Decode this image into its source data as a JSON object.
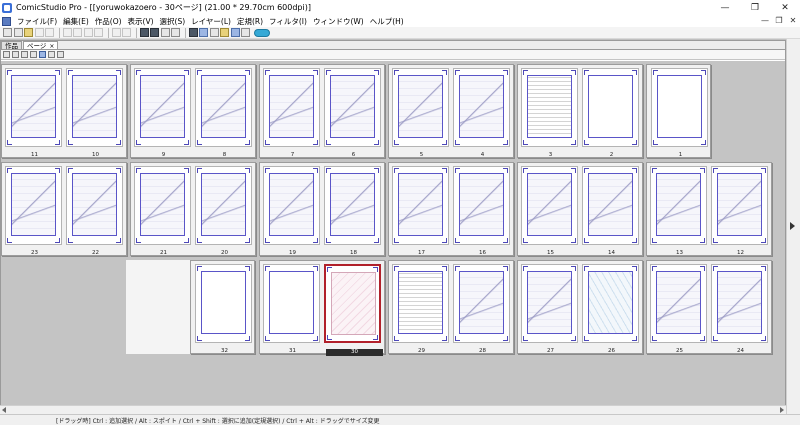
{
  "window": {
    "title": "ComicStudio Pro - [[yoruwokazoero - 30ページ] (21.00 * 29.70cm 600dpi)]",
    "controls": [
      "—",
      "❐",
      "✕"
    ]
  },
  "menu": {
    "items": [
      "ファイル(F)",
      "編集(E)",
      "作品(O)",
      "表示(V)",
      "選択(S)",
      "レイヤー(L)",
      "定規(R)",
      "フィルタ(I)",
      "ウィンドウ(W)",
      "ヘルプ(H)"
    ],
    "mdi_controls": [
      "—",
      "❐",
      "✕"
    ]
  },
  "doc_tabs": [
    {
      "label": "作品",
      "active": false
    },
    {
      "label": "ページ",
      "active": true,
      "close": "×"
    }
  ],
  "pages": {
    "row1": [
      {
        "num": "11",
        "style": "art"
      },
      {
        "num": "10",
        "style": "art"
      },
      {
        "num": "9",
        "style": "art"
      },
      {
        "num": "8",
        "style": "art"
      },
      {
        "num": "7",
        "style": "art"
      },
      {
        "num": "6",
        "style": "art"
      },
      {
        "num": "5",
        "style": "art"
      },
      {
        "num": "4",
        "style": "art"
      },
      {
        "num": "3",
        "style": "text"
      },
      {
        "num": "2",
        "style": "blank"
      },
      {
        "num": "1",
        "style": "blank"
      }
    ],
    "row2": [
      {
        "num": "23",
        "style": "art"
      },
      {
        "num": "22",
        "style": "art"
      },
      {
        "num": "21",
        "style": "art"
      },
      {
        "num": "20",
        "style": "art"
      },
      {
        "num": "19",
        "style": "art"
      },
      {
        "num": "18",
        "style": "art"
      },
      {
        "num": "17",
        "style": "art"
      },
      {
        "num": "16",
        "style": "art"
      },
      {
        "num": "15",
        "style": "art"
      },
      {
        "num": "14",
        "style": "art"
      },
      {
        "num": "13",
        "style": "art"
      },
      {
        "num": "12",
        "style": "art"
      }
    ],
    "row3": [
      {
        "num": "32",
        "style": "blank"
      },
      {
        "num": "31",
        "style": "blank"
      },
      {
        "num": "30",
        "style": "pink",
        "selected": true
      },
      {
        "num": "29",
        "style": "text"
      },
      {
        "num": "28",
        "style": "art"
      },
      {
        "num": "27",
        "style": "art"
      },
      {
        "num": "26",
        "style": "blue-art"
      },
      {
        "num": "25",
        "style": "art"
      },
      {
        "num": "24",
        "style": "art"
      }
    ]
  },
  "status": {
    "text": "[ドラッグ時] Ctrl : 追加選択 / Alt : スポイト / Ctrl + Shift : 選択に追加(定規選択) / Ctrl + Alt : ドラッグでサイズ変更"
  }
}
